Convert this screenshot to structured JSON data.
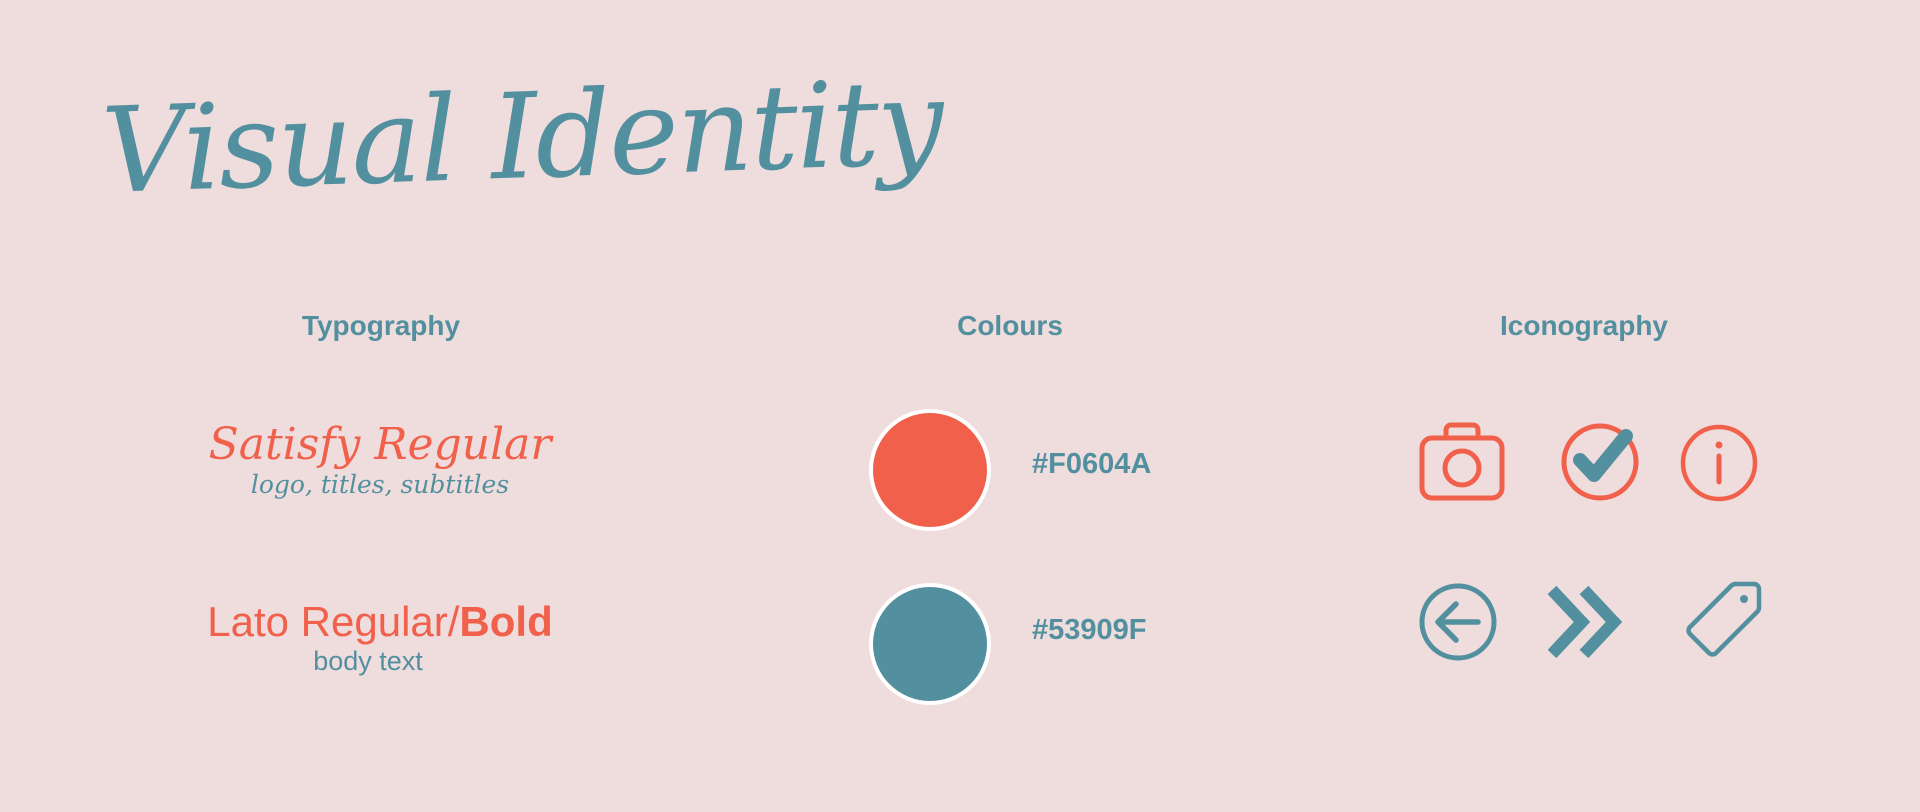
{
  "title": "Visual Identity",
  "sections": {
    "typography": "Typography",
    "colours": "Colours",
    "iconography": "Iconography"
  },
  "typography": {
    "font1": {
      "name": "Satisfy Regular",
      "usage": "logo, titles, subtitles"
    },
    "font2": {
      "name_regular": "Lato Regular/",
      "name_bold": "Bold",
      "usage": "body text"
    }
  },
  "colours": [
    {
      "hex": "#F0604A",
      "label": "#F0604A"
    },
    {
      "hex": "#53909F",
      "label": "#53909F"
    }
  ],
  "icons": [
    "camera-icon",
    "check-circle-icon",
    "info-icon",
    "arrow-left-circle-icon",
    "chevrons-right-icon",
    "tag-icon"
  ],
  "palette": {
    "background": "#efdcdc",
    "accent_coral": "#f0604a",
    "accent_teal": "#53909f"
  }
}
